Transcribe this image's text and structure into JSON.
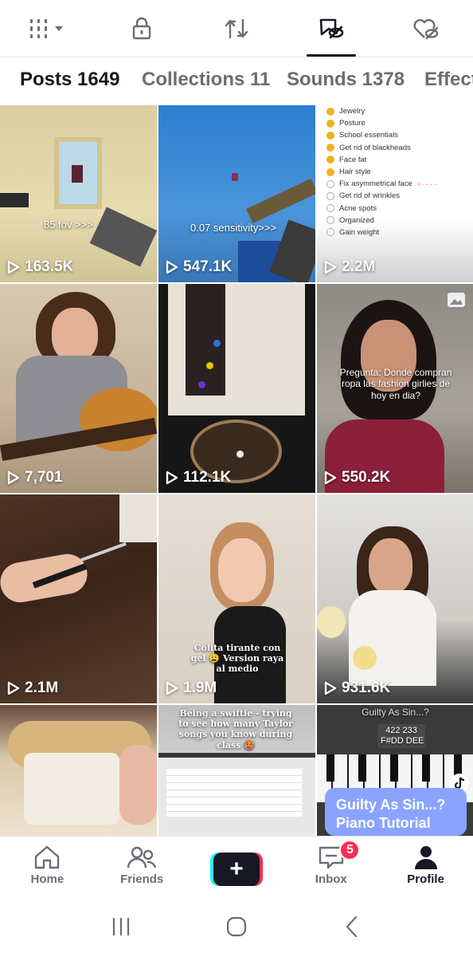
{
  "top_tabs": [
    {
      "icon": "grid-menu-icon",
      "active": false
    },
    {
      "icon": "lock-icon",
      "active": false
    },
    {
      "icon": "repost-icon",
      "active": false
    },
    {
      "icon": "favorites-hidden-icon",
      "active": true
    },
    {
      "icon": "liked-hidden-icon",
      "active": false
    }
  ],
  "content_tabs": [
    {
      "label": "Posts 1649",
      "active": true
    },
    {
      "label": "Collections 11",
      "active": false
    },
    {
      "label": "Sounds 1378",
      "active": false
    },
    {
      "label": "Effect",
      "active": false
    }
  ],
  "grid": [
    {
      "views": "163.5K",
      "overlay": "85 fov >>>"
    },
    {
      "views": "547.1K",
      "overlay": "0.07 sensitivity>>>"
    },
    {
      "views": "2.2M",
      "checklist": [
        "Jewelry",
        "Posture",
        "School essentials",
        "Get rid of blackheads",
        "Face fat",
        "Hair style",
        "Fix asymmetrical face",
        "Get rid of wrinkles",
        "Acne spots",
        "Organized",
        "Gain weight"
      ]
    },
    {
      "views": "7,701"
    },
    {
      "views": "112.1K"
    },
    {
      "views": "550.2K",
      "overlay": "Pregunta: Donde compran ropa las fashion girlies de hoy en dia?"
    },
    {
      "views": "2.1M"
    },
    {
      "views": "1.9M",
      "overlay": "Colita tirante con gel 😩 Version raya al medio"
    },
    {
      "views": "931.6K"
    },
    {
      "views": ""
    },
    {
      "views": "",
      "overlay": "Being a swiftie - trying to see how many Taylor songs you know during class 🥵"
    },
    {
      "views": "",
      "overlay_top": "Guilty As Sin...?",
      "chords": "422 233\nF#DD DEE",
      "card": "Guilty As Sin...? Piano Tutorial"
    }
  ],
  "bottom_nav": {
    "home": "Home",
    "friends": "Friends",
    "create": "+",
    "inbox": "Inbox",
    "inbox_badge": "5",
    "profile": "Profile"
  },
  "colors": {
    "accent": "#fe2c55",
    "cyan": "#25f4ee",
    "text": "#161823",
    "muted": "#6b6d75",
    "checked": "#f2b01e"
  }
}
